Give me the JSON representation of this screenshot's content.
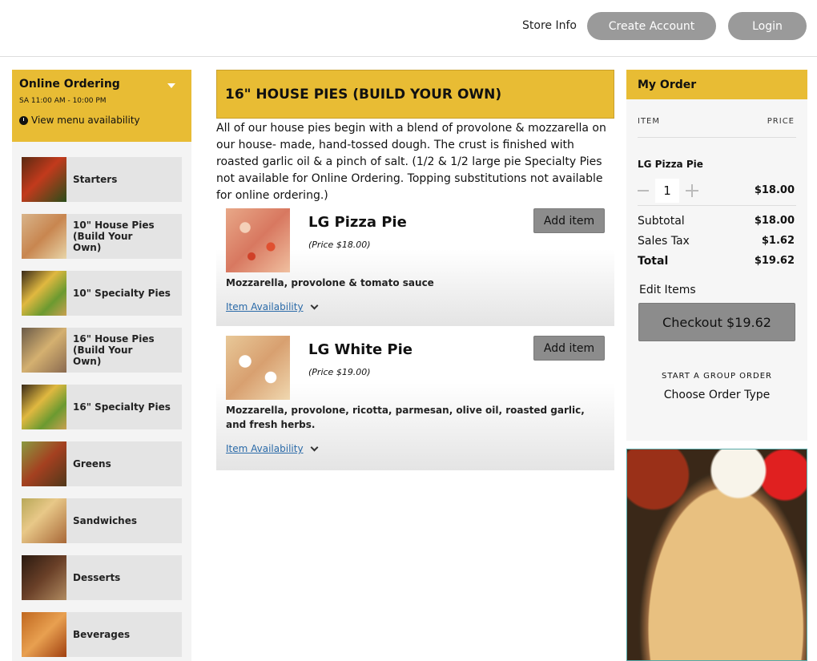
{
  "header": {
    "store_info": "Store Info",
    "create_account": "Create Account",
    "login": "Login"
  },
  "sidebar": {
    "title": "Online Ordering",
    "hours": "SA 11:00 AM - 10:00 PM",
    "availability_link": "View menu availability",
    "categories": [
      {
        "label": "Starters"
      },
      {
        "label": "10\" House Pies (Build Your Own)"
      },
      {
        "label": "10\" Specialty Pies"
      },
      {
        "label": "16\" House Pies (Build Your Own)"
      },
      {
        "label": "16\" Specialty Pies"
      },
      {
        "label": "Greens"
      },
      {
        "label": "Sandwiches"
      },
      {
        "label": "Desserts"
      },
      {
        "label": "Beverages"
      }
    ]
  },
  "main": {
    "category_title": "16\" HOUSE PIES (BUILD YOUR OWN)",
    "description": "All of our house pies begin with a blend of provolone & mozzarella on our house- made, hand-tossed dough. The crust is finished with roasted garlic oil & a pinch of salt. (1/2 & 1/2 large pie Specialty Pies not available for Online Ordering. Topping substitutions not available for online ordering.)",
    "items": [
      {
        "name": "LG Pizza Pie",
        "price": "(Price $18.00)",
        "add_label": "Add item",
        "description": "Mozzarella, provolone & tomato sauce",
        "availability": "Item Availability"
      },
      {
        "name": "LG White Pie",
        "price": "(Price $19.00)",
        "add_label": "Add item",
        "description": "Mozzarella, provolone, ricotta, parmesan, olive oil, roasted garlic, and fresh herbs.",
        "availability": "Item Availability"
      }
    ]
  },
  "order": {
    "title": "My Order",
    "col_item": "ITEM",
    "col_price": "PRICE",
    "line_item": {
      "name": "LG Pizza Pie",
      "qty": "1",
      "price": "$18.00"
    },
    "subtotal_label": "Subtotal",
    "subtotal": "$18.00",
    "tax_label": "Sales Tax",
    "tax": "$1.62",
    "total_label": "Total",
    "total": "$19.62",
    "edit_items": "Edit Items",
    "checkout": "Checkout $19.62",
    "group_order": "START A GROUP ORDER",
    "order_type": "Choose Order Type"
  },
  "colors": {
    "accent": "#e8bc34",
    "button_gray": "#8c8c8c",
    "link": "#2a6aa8"
  }
}
